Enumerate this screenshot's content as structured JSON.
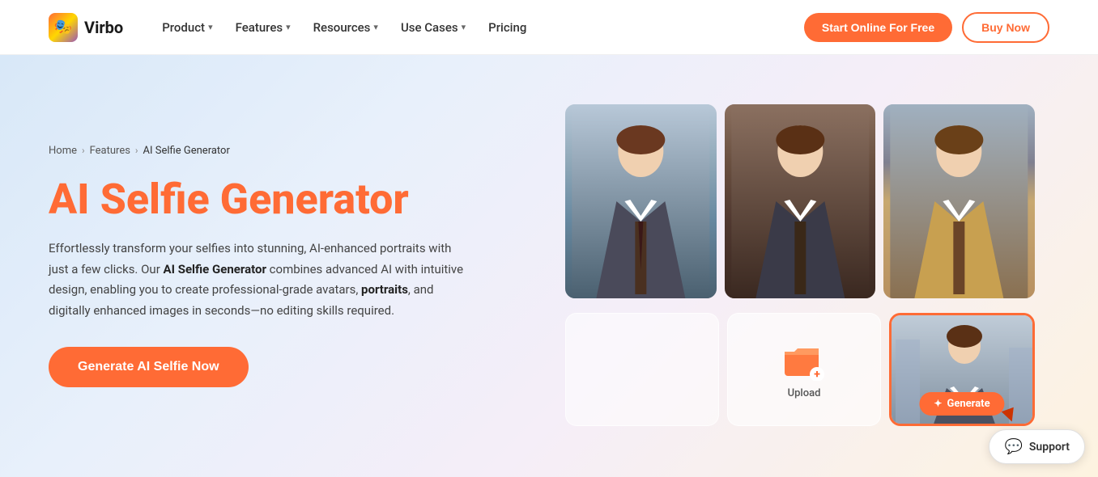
{
  "brand": {
    "logo_emoji": "🎭",
    "name": "Virbo"
  },
  "nav": {
    "product_label": "Product",
    "features_label": "Features",
    "resources_label": "Resources",
    "use_cases_label": "Use Cases",
    "pricing_label": "Pricing",
    "start_btn": "Start Online For Free",
    "buy_btn": "Buy Now"
  },
  "breadcrumb": {
    "home": "Home",
    "features": "Features",
    "current": "AI Selfie Generator"
  },
  "hero": {
    "title": "AI Selfie Generator",
    "description_plain": "Effortlessly transform your selfies into stunning, AI-enhanced portraits with just a few clicks. Our ",
    "description_bold": "AI Selfie Generator",
    "description_end": " combines advanced AI with intuitive design, enabling you to create professional-grade avatars, ",
    "portraits_bold": "portraits",
    "description_final": ", and digitally enhanced images in seconds—no editing skills required.",
    "cta_btn": "Generate AI Selfie Now"
  },
  "upload": {
    "label": "Upload"
  },
  "generate_btn": "Generate",
  "support": {
    "label": "Support",
    "icon": "💬"
  }
}
